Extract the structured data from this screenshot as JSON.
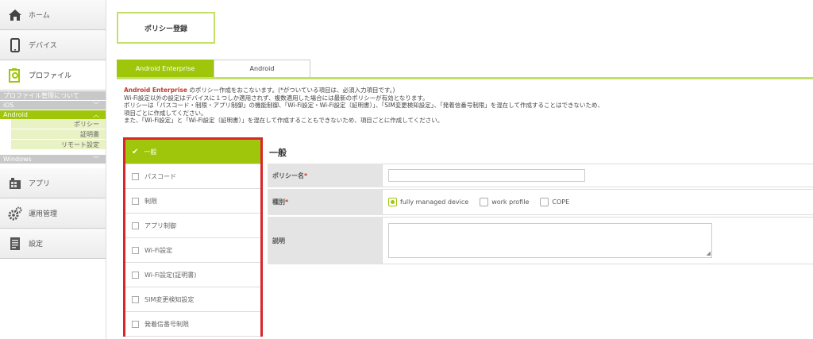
{
  "sidebar": {
    "home": "ホーム",
    "devices": "デバイス",
    "profile": "プロファイル",
    "profile_about": "プロファイル管理について",
    "ios": "iOS",
    "android": "Android",
    "android_items": [
      "ポリシー",
      "証明書",
      "リモート設定"
    ],
    "windows": "Windows",
    "apps": "アプリ",
    "operations": "運用管理",
    "settings": "設定"
  },
  "page": {
    "title": "ポリシー登録",
    "tabs": [
      "Android Enterprise",
      "Android"
    ]
  },
  "notes": {
    "brand": "Android Enterprise",
    "line1_rest": " のポリシー作成をおこないます。(*がついている項目は、必須入力項目です。)",
    "line2": "Wi-Fi設定以外の設定はデバイスに１つしか適用されず、複数適用した場合には最新のポリシーが有効となります。",
    "line3": "ポリシーは「パスコード・制限・アプリ制御」の機能制御、「Wi-Fi設定・Wi-Fi設定（証明書）」、「SIM変更検知設定」、「発着信番号制限」を混在して作成することはできないため、",
    "line4": "項目ごとに作成してください。",
    "line5": "また、「Wi-Fi設定」と「Wi-Fi設定（証明書）」を混在して作成することもできないため、項目ごとに作成してください。"
  },
  "categories": [
    "一般",
    "パスコード",
    "制限",
    "アプリ制御",
    "Wi-Fi設定",
    "Wi-Fi設定(証明書)",
    "SIM変更検知設定",
    "発着信番号制限"
  ],
  "form": {
    "section_title": "一般",
    "policy_name_label": "ポリシー名",
    "type_label": "種別",
    "required_mark": "*",
    "type_options": [
      "fully managed device",
      "work profile",
      "COPE"
    ],
    "type_selected": "fully managed device",
    "description_label": "説明"
  },
  "colors": {
    "accent": "#9fc60a",
    "highlight": "#d9262b",
    "required": "#c0392b"
  }
}
